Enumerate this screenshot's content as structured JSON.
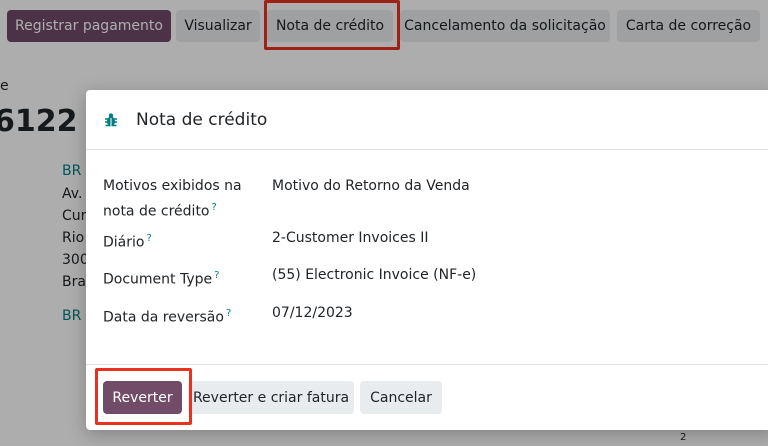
{
  "toolbar": {
    "buttons": [
      {
        "label": "Registrar pagamento"
      },
      {
        "label": "Visualizar"
      },
      {
        "label": "Nota de crédito"
      },
      {
        "label": "Cancelamento da solicitação"
      },
      {
        "label": "Carta de correção"
      }
    ]
  },
  "background": {
    "fragments": [
      "e",
      "6122",
      "BR C",
      "Av.",
      "Cur",
      "Rio",
      "300",
      "Bras",
      "BR C",
      "2"
    ]
  },
  "modal": {
    "icon": "bug-icon",
    "title": "Nota de crédito",
    "fields": [
      {
        "label_line1": "Motivos exibidos na",
        "label_line2": "nota de crédito",
        "help": "?",
        "value": "Motivo do Retorno da Venda"
      },
      {
        "label": "Diário",
        "help": "?",
        "value": "2-Customer Invoices II"
      },
      {
        "label": "Document Type",
        "help": "?",
        "value": "(55) Electronic Invoice (NF-e)"
      },
      {
        "label": "Data da reversão",
        "help": "?",
        "value": "07/12/2023"
      }
    ],
    "footer": {
      "reverse": "Reverter",
      "reverse_invoice": "Reverter e criar fatura",
      "cancel": "Cancelar"
    }
  },
  "colors": {
    "primary": "#714b67",
    "link": "#017e84",
    "highlight": "#e8321e",
    "overlay": "rgba(0,0,0,0.32)"
  }
}
